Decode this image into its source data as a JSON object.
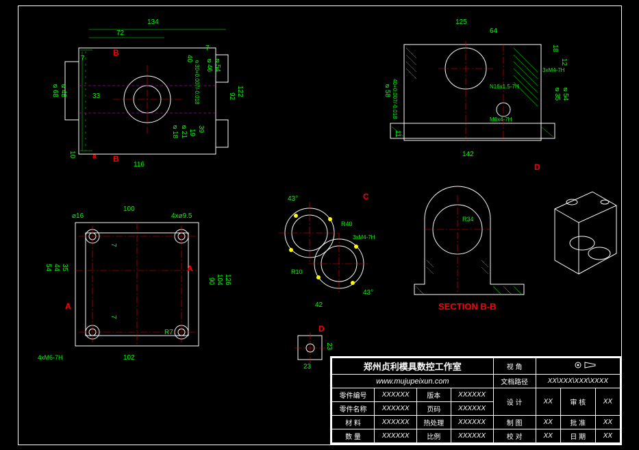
{
  "frame": {},
  "top_left_view": {
    "dims": {
      "w134": "134",
      "w72": "72",
      "w33": "33",
      "w116": "116",
      "w10": "10",
      "w40": "40",
      "w7l": "7",
      "w7r": "7",
      "h122": "122",
      "h92": "92",
      "h40": "40",
      "h39": "39",
      "h19": "19",
      "d68": "⌀68",
      "d48": "⌀48",
      "d46": "⌀46",
      "d54": "⌀54",
      "d18": "⌀18",
      "d21": "⌀21",
      "tol": "⌀30+0.007/-0.018"
    },
    "sec_b1": "B",
    "sec_b2": "B",
    "sec_a": "a"
  },
  "top_right_view": {
    "dims": {
      "w125": "125",
      "w64": "64",
      "w142": "142",
      "w11": "11",
      "h18": "18",
      "h12": "12",
      "h40": "40",
      "d58": "⌀58",
      "d35": "⌀35",
      "d54": "⌀54",
      "tol": "40+0.007/-0.018",
      "n1": "N16x1.5-7H",
      "n2": "M8x4-7H",
      "n3": "3xM4-7H"
    },
    "sec_d": "D"
  },
  "bottom_left_view": {
    "dims": {
      "w100": "100",
      "w102": "102",
      "w7a": "7",
      "w7b": "7",
      "h54": "54",
      "h44": "44",
      "h35": "35",
      "h90": "90",
      "h104": "104",
      "h126": "126",
      "d16": "⌀16",
      "r7": "R7",
      "n1": "4x⌀9.5",
      "n2": "4xM6-7H"
    },
    "sec_a1": "A",
    "sec_a2": "A"
  },
  "view_c": {
    "label": "C",
    "dims": {
      "a43a": "43°",
      "a43b": "43°",
      "w42": "42",
      "r10": "R10",
      "r40": "R40",
      "n1": "3xM4-7H"
    }
  },
  "view_bb": {
    "label": "SECTION B-B",
    "dims": {
      "r34": "R34"
    }
  },
  "view_d": {
    "label": "D",
    "dims": {
      "w23": "23",
      "h23": "23"
    }
  },
  "iso_view": {},
  "title": {
    "company": "郑州贞利模具数控工作室",
    "url": "www.mujupeixun.com",
    "rows": {
      "r1": {
        "a": "零件编号",
        "b": "XXXXXX",
        "c": "版本",
        "d": "XXXXXX"
      },
      "r2": {
        "a": "零件名称",
        "b": "XXXXXX",
        "c": "页码",
        "d": "XXXXXX"
      },
      "r3": {
        "a": "材 料",
        "b": "XXXXXX",
        "c": "热处理",
        "d": "XXXXXX"
      },
      "r4": {
        "a": "数 量",
        "b": "XXXXXX",
        "c": "比例",
        "d": "XXXXXX"
      }
    },
    "right": {
      "h1": "视 角",
      "h2": "文档路径",
      "path": "XX\\XXX\\XXX\\XXXX",
      "r1": {
        "a": "设 计",
        "b": "XX",
        "c": "审 核",
        "d": "XX"
      },
      "r2": {
        "a": "制 图",
        "b": "XX",
        "c": "批 准",
        "d": "XX"
      },
      "r3": {
        "a": "校 对",
        "b": "XX",
        "c": "日 期",
        "d": "XX"
      }
    }
  }
}
